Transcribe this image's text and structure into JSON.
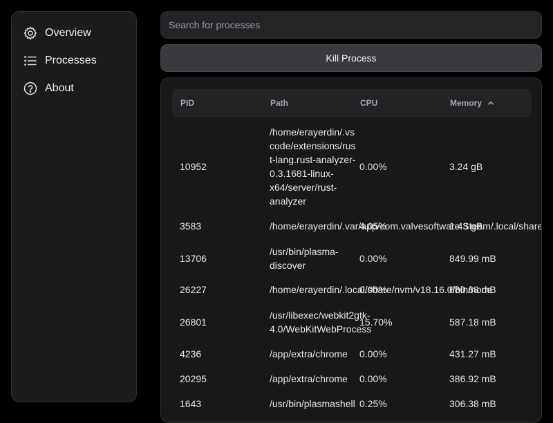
{
  "sidebar": {
    "items": [
      {
        "label": "Overview",
        "icon": "gear-icon"
      },
      {
        "label": "Processes",
        "icon": "list-icon"
      },
      {
        "label": "About",
        "icon": "question-icon"
      }
    ]
  },
  "search": {
    "placeholder": "Search for processes",
    "value": ""
  },
  "toolbar": {
    "kill_label": "Kill Process"
  },
  "table": {
    "columns": [
      "PID",
      "Path",
      "CPU",
      "Memory"
    ],
    "sort": {
      "column": "Memory",
      "direction": "ascending-indicator"
    },
    "rows": [
      {
        "pid": "10952",
        "path": "/home/erayerdin/.vscode/extensions/rust-lang.rust-analyzer-0.3.1681-linux-x64/server/rust-analyzer",
        "cpu": "0.00%",
        "memory": "3.24 gB"
      },
      {
        "pid": "3583",
        "path": "/home/erayerdin/.var/app/com.valvesoftware.Steam/.local/share/Steam",
        "cpu": "4.05%",
        "memory": "1.43 gB"
      },
      {
        "pid": "13706",
        "path": "/usr/bin/plasma-discover",
        "cpu": "0.00%",
        "memory": "849.99 mB"
      },
      {
        "pid": "26227",
        "path": "/home/erayerdin/.local/share/nvm/v18.16.0/bin/node",
        "cpu": "0.00%",
        "memory": "680.68 mB"
      },
      {
        "pid": "26801",
        "path": "/usr/libexec/webkit2gtk-4.0/WebKitWebProcess",
        "cpu": "15.70%",
        "memory": "587.18 mB"
      },
      {
        "pid": "4236",
        "path": "/app/extra/chrome",
        "cpu": "0.00%",
        "memory": "431.27 mB"
      },
      {
        "pid": "20295",
        "path": "/app/extra/chrome",
        "cpu": "0.00%",
        "memory": "386.92 mB"
      },
      {
        "pid": "1643",
        "path": "/usr/bin/plasmashell",
        "cpu": "0.25%",
        "memory": "306.38 mB"
      }
    ]
  }
}
